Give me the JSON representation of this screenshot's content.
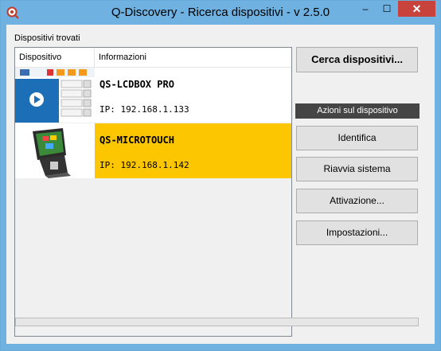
{
  "window": {
    "title": "Q-Discovery - Ricerca dispositivi - v 2.5.0",
    "minimize": "–",
    "maximize": "☐",
    "close": "✕"
  },
  "devices_panel": {
    "label": "Dispositivi trovati",
    "columns": {
      "device": "Dispositivo",
      "info": "Informazioni"
    },
    "rows": [
      {
        "name": "QS-LCDBOX PRO",
        "ip": "IP: 192.168.1.133",
        "selected": false
      },
      {
        "name": "QS-MICROTOUCH",
        "ip": "IP: 192.168.1.142",
        "selected": true
      }
    ]
  },
  "actions": {
    "search": "Cerca dispositivi...",
    "section_title": "Azioni sul dispositivo",
    "identify": "Identifica",
    "restart": "Riavvia sistema",
    "activate": "Attivazione...",
    "settings": "Impostazioni..."
  },
  "progress": {
    "value": 0
  },
  "colors": {
    "titlebar": "#6fb1e0",
    "selection": "#fcc600",
    "close": "#c7433b"
  }
}
